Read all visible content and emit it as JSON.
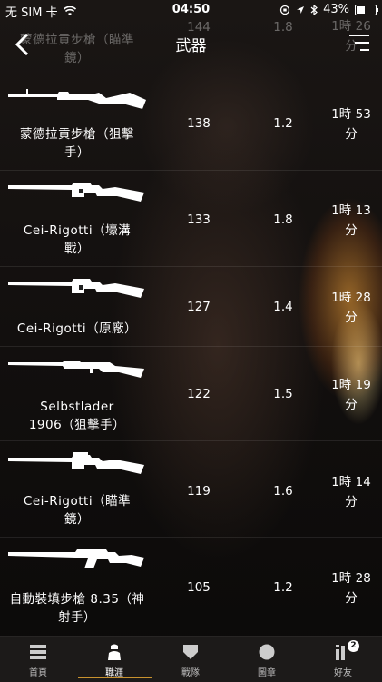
{
  "status_bar": {
    "carrier": "无 SIM 卡",
    "time": "04:50",
    "battery": "43%",
    "battery_level": 0.43
  },
  "nav": {
    "title": "武器",
    "back_icon": "chevron-left-icon",
    "filter_icon": "filter-lines-icon"
  },
  "partial_row": {
    "name_line1": "蒙德拉貢步槍（瞄準",
    "name_line2": "鏡）",
    "kills": "144",
    "kpm": "1.8",
    "time_line1": "1時 26",
    "time_line2": "分"
  },
  "weapons": [
    {
      "name_line1": "蒙德拉貢步槍（狙擊",
      "name_line2": "手）",
      "kills": "138",
      "kpm": "1.2",
      "time_line1": "1時 53",
      "time_line2": "分"
    },
    {
      "name_line1": "Cei-Rigotti（壕溝",
      "name_line2": "戰）",
      "kills": "133",
      "kpm": "1.8",
      "time_line1": "1時 13",
      "time_line2": "分"
    },
    {
      "name_line1": "Cei-Rigotti（原廠）",
      "name_line2": "",
      "kills": "127",
      "kpm": "1.4",
      "time_line1": "1時 28",
      "time_line2": "分"
    },
    {
      "name_line1": "Selbstlader",
      "name_line2": "1906（狙擊手）",
      "kills": "122",
      "kpm": "1.5",
      "time_line1": "1時 19",
      "time_line2": "分"
    },
    {
      "name_line1": "Cei-Rigotti（瞄準",
      "name_line2": "鏡）",
      "kills": "119",
      "kpm": "1.6",
      "time_line1": "1時 14",
      "time_line2": "分"
    },
    {
      "name_line1": "自動裝填步槍 8.35（神",
      "name_line2": "射手）",
      "kills": "105",
      "kpm": "1.2",
      "time_line1": "1時 28",
      "time_line2": "分"
    }
  ],
  "tabs": [
    {
      "label": "首頁",
      "icon": "home-list-icon"
    },
    {
      "label": "職涯",
      "icon": "soldier-icon",
      "active": true
    },
    {
      "label": "戰隊",
      "icon": "shield-icon"
    },
    {
      "label": "圖章",
      "icon": "emblem-circle-icon"
    },
    {
      "label": "好友",
      "icon": "friends-icon",
      "badge": "2"
    }
  ],
  "colors": {
    "accent": "#c8922e",
    "tabbar_bg": "#1c1a19"
  }
}
